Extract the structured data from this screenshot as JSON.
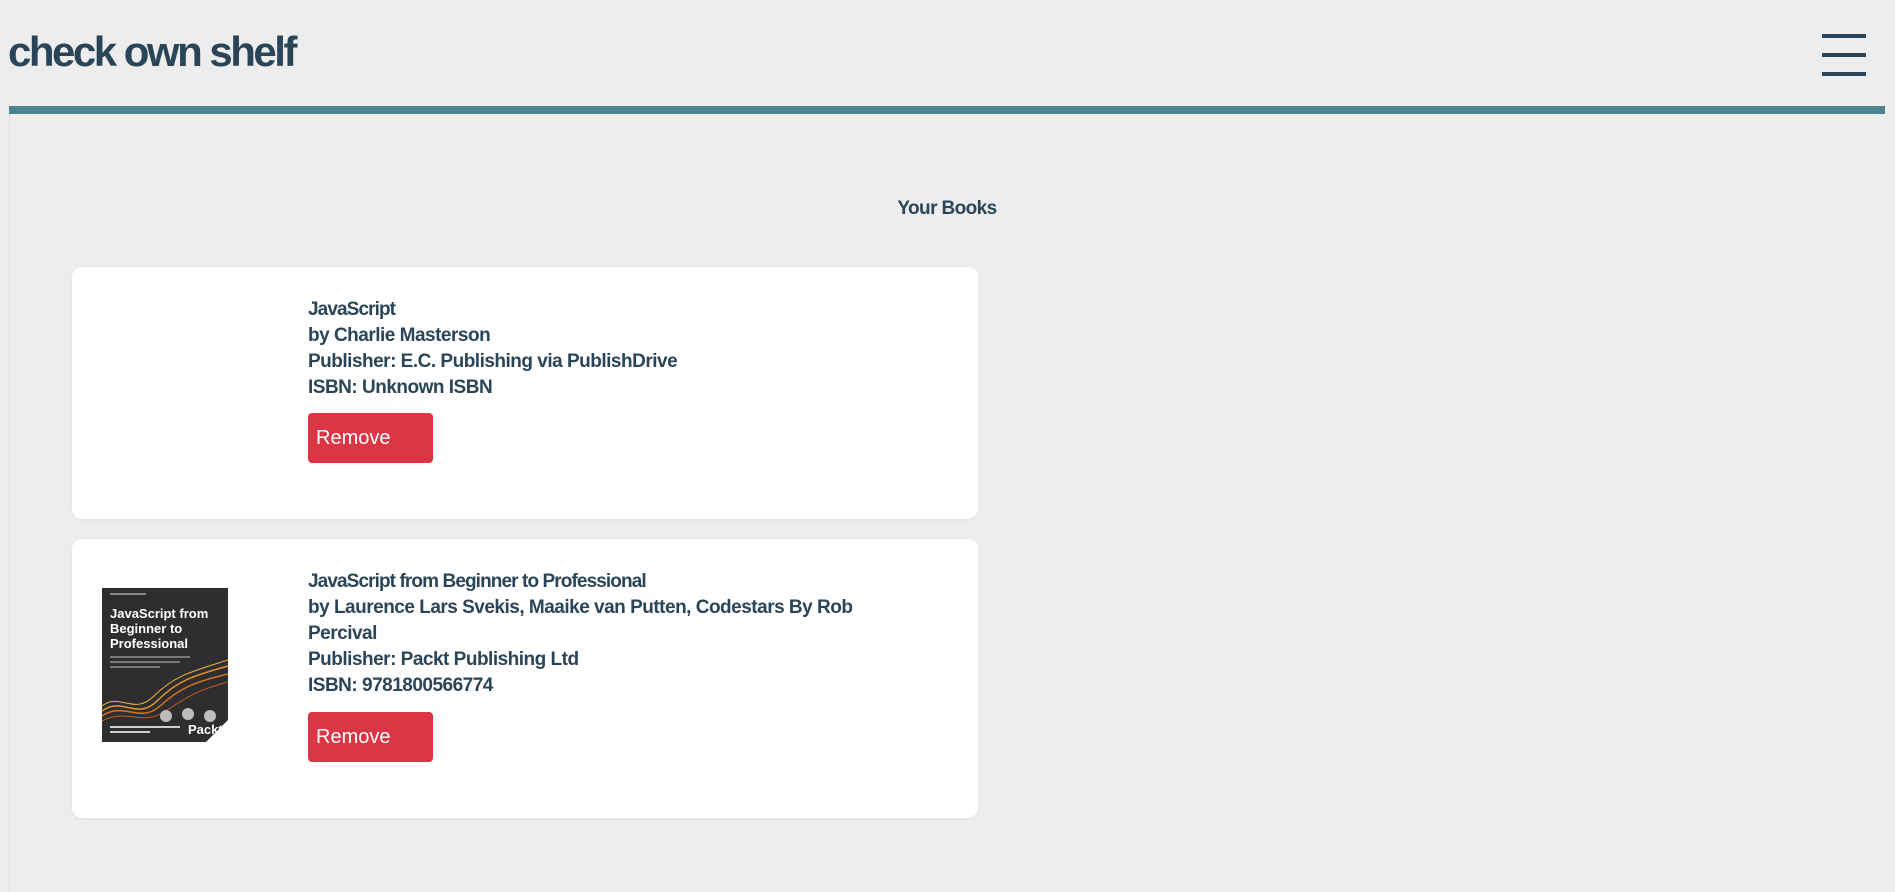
{
  "header": {
    "brand": "check own shelf",
    "menu_icon": "hamburger-menu-icon"
  },
  "colors": {
    "background": "#ededed",
    "text": "#2a4558",
    "accent_rule": "#4e8390",
    "remove_button": "#dc3545",
    "card": "#ffffff"
  },
  "main": {
    "section_title": "Your Books",
    "books": [
      {
        "title": "JavaScript",
        "authors": "by Charlie Masterson",
        "publisher": "Publisher: E.C. Publishing via PublishDrive",
        "isbn": "ISBN: Unknown ISBN",
        "remove_label": "Remove"
      },
      {
        "title": "JavaScript from Beginner to Professional",
        "authors": "by Laurence Lars Svekis, Maaike van Putten, Codestars By Rob Percival",
        "publisher": "Publisher: Packt Publishing Ltd",
        "isbn": "ISBN: 9781800566774",
        "remove_label": "Remove",
        "cover": {
          "title": "JavaScript from Beginner to Professional",
          "publisher_mark": "Packt"
        }
      }
    ]
  }
}
